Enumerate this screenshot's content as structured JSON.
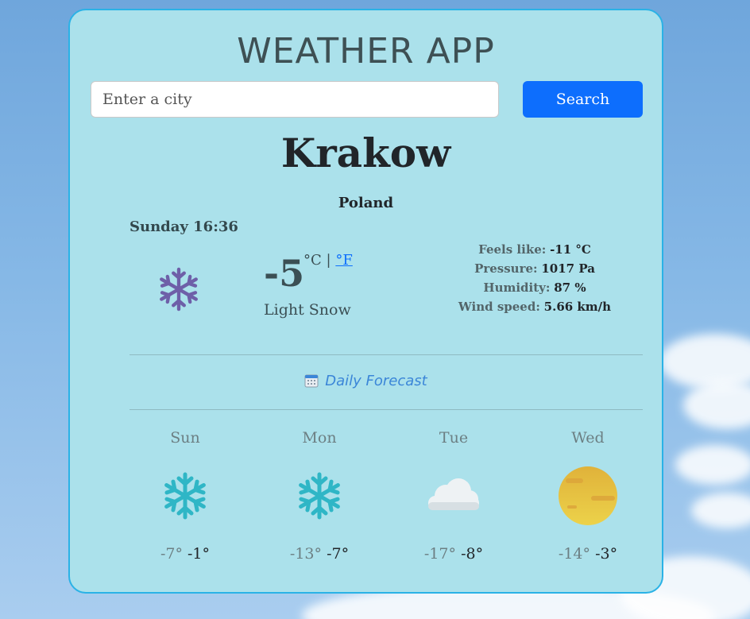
{
  "app": {
    "title": "WEATHER APP"
  },
  "search": {
    "placeholder": "Enter a city",
    "button_label": "Search"
  },
  "current": {
    "city": "Krakow",
    "country": "Poland",
    "date_time": "Sunday 16:36",
    "icon": "snowflake-icon",
    "temperature": "-5",
    "unit_c": "°C",
    "unit_separator": "|",
    "unit_f": "°F",
    "description": "Light Snow",
    "feels_like": {
      "label": "Feels like:",
      "value": "-11 °C"
    },
    "pressure": {
      "label": "Pressure:",
      "value": "1017 Pa"
    },
    "humidity": {
      "label": "Humidity:",
      "value": "87 %"
    },
    "wind_speed": {
      "label": "Wind speed:",
      "value": "5.66 km/h"
    }
  },
  "forecast": {
    "title": "Daily Forecast",
    "days": [
      {
        "name": "Sun",
        "icon": "snowflake-icon",
        "min": "-7°",
        "max": "-1°"
      },
      {
        "name": "Mon",
        "icon": "snowflake-icon",
        "min": "-13°",
        "max": "-7°"
      },
      {
        "name": "Tue",
        "icon": "cloud-icon",
        "min": "-17°",
        "max": "-8°"
      },
      {
        "name": "Wed",
        "icon": "haze-sun-icon",
        "min": "-14°",
        "max": "-3°"
      }
    ]
  },
  "colors": {
    "accent": "#0d6efd",
    "card_bg": "#abe1eb",
    "card_border": "#2ab2e6",
    "forecast_title": "#3b86d8"
  }
}
